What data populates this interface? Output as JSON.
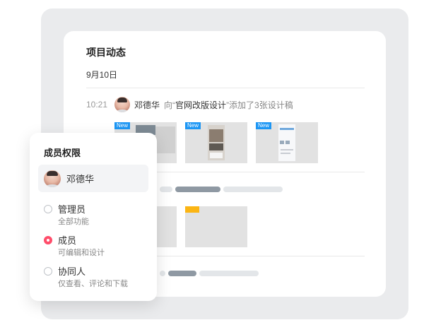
{
  "feed": {
    "title": "项目动态",
    "date": "9月10日",
    "activity": {
      "time": "10:21",
      "user": "邓德华",
      "prefix": "向“",
      "project": "官网改版设计",
      "suffix": "”添加了3张设计稿"
    },
    "thumbnails": [
      {
        "badge": "New"
      },
      {
        "badge": "New"
      },
      {
        "badge": "New"
      }
    ]
  },
  "permissions": {
    "title": "成员权限",
    "member_name": "邓德华",
    "roles": [
      {
        "name": "管理员",
        "desc": "全部功能",
        "selected": false
      },
      {
        "name": "成员",
        "desc": "可编辑和设计",
        "selected": true
      },
      {
        "name": "协同人",
        "desc": "仅查看、评论和下载",
        "selected": false
      }
    ]
  },
  "colors": {
    "accent": "#ff4d6a",
    "new_badge": "#1c96f4",
    "tag_yellow": "#fbb514",
    "backdrop": "#eaebed"
  }
}
